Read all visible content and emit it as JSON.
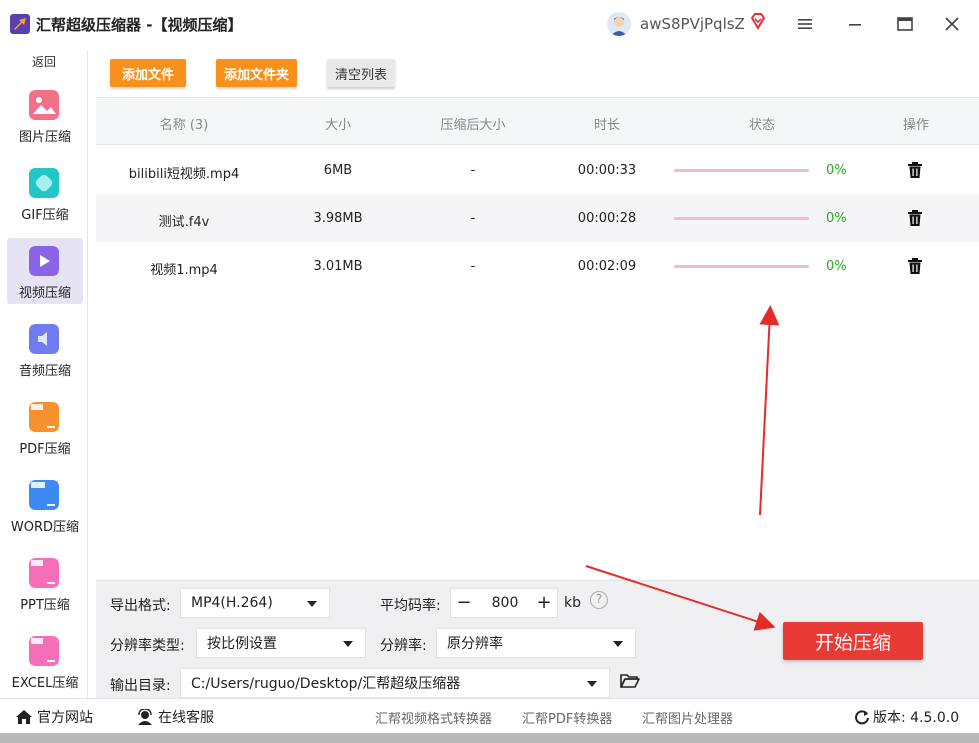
{
  "window": {
    "app_title": "汇帮超级压缩器  -【视频压缩】",
    "username": "awS8PVjPqlsZ"
  },
  "sidebar": {
    "back_label": "返回",
    "items": [
      {
        "label": "图片压缩",
        "icon": "image-compress-icon",
        "color": "#f2708a"
      },
      {
        "label": "GIF压缩",
        "icon": "gif-compress-icon",
        "color": "#23c6c6"
      },
      {
        "label": "视频压缩",
        "icon": "video-compress-icon",
        "color": "#8a63e6"
      },
      {
        "label": "音频压缩",
        "icon": "audio-compress-icon",
        "color": "#6f7cf0"
      },
      {
        "label": "PDF压缩",
        "icon": "pdf-compress-icon",
        "color": "#f7912e"
      },
      {
        "label": "WORD压缩",
        "icon": "word-compress-icon",
        "color": "#3d8af5"
      },
      {
        "label": "PPT压缩",
        "icon": "ppt-compress-icon",
        "color": "#f56fb8"
      },
      {
        "label": "EXCEL压缩",
        "icon": "excel-compress-icon",
        "color": "#f56fb8"
      }
    ],
    "active_index": 2
  },
  "toolbar": {
    "add_file": "添加文件",
    "add_folder": "添加文件夹",
    "clear_list": "清空列表"
  },
  "table": {
    "headers": [
      "名称 (3)",
      "大小",
      "压缩后大小",
      "时长",
      "状态",
      "操作"
    ],
    "rows": [
      {
        "name": "bilibili短视频.mp4",
        "size": "6MB",
        "compressed": "-",
        "duration": "00:00:33",
        "progress": "0%"
      },
      {
        "name": "测试.f4v",
        "size": "3.98MB",
        "compressed": "-",
        "duration": "00:00:28",
        "progress": "0%"
      },
      {
        "name": "视频1.mp4",
        "size": "3.01MB",
        "compressed": "-",
        "duration": "00:02:09",
        "progress": "0%"
      }
    ]
  },
  "settings": {
    "format_label": "导出格式:",
    "format_value": "MP4(H.264)",
    "bitrate_label": "平均码率:",
    "bitrate_value": "800",
    "bitrate_unit": "kb",
    "help_glyph": "?",
    "minus": "−",
    "plus": "+",
    "res_type_label": "分辨率类型:",
    "res_type_value": "按比例设置",
    "res_label": "分辨率:",
    "res_value": "原分辨率",
    "output_label": "输出目录:",
    "output_value": "C:/Users/ruguo/Desktop/汇帮超级压缩器",
    "start_label": "开始压缩"
  },
  "statusbar": {
    "website": "官方网站",
    "support": "在线客服",
    "links": [
      "汇帮视频格式转换器",
      "汇帮PDF转换器",
      "汇帮图片处理器"
    ],
    "version": "版本:  4.5.0.0"
  },
  "colors": {
    "accent_orange": "#f7911c",
    "start_red": "#e93b36",
    "progress_pink": "#eebdcc",
    "percent_green": "#22aa22",
    "annotation_red": "#e52a2a"
  }
}
